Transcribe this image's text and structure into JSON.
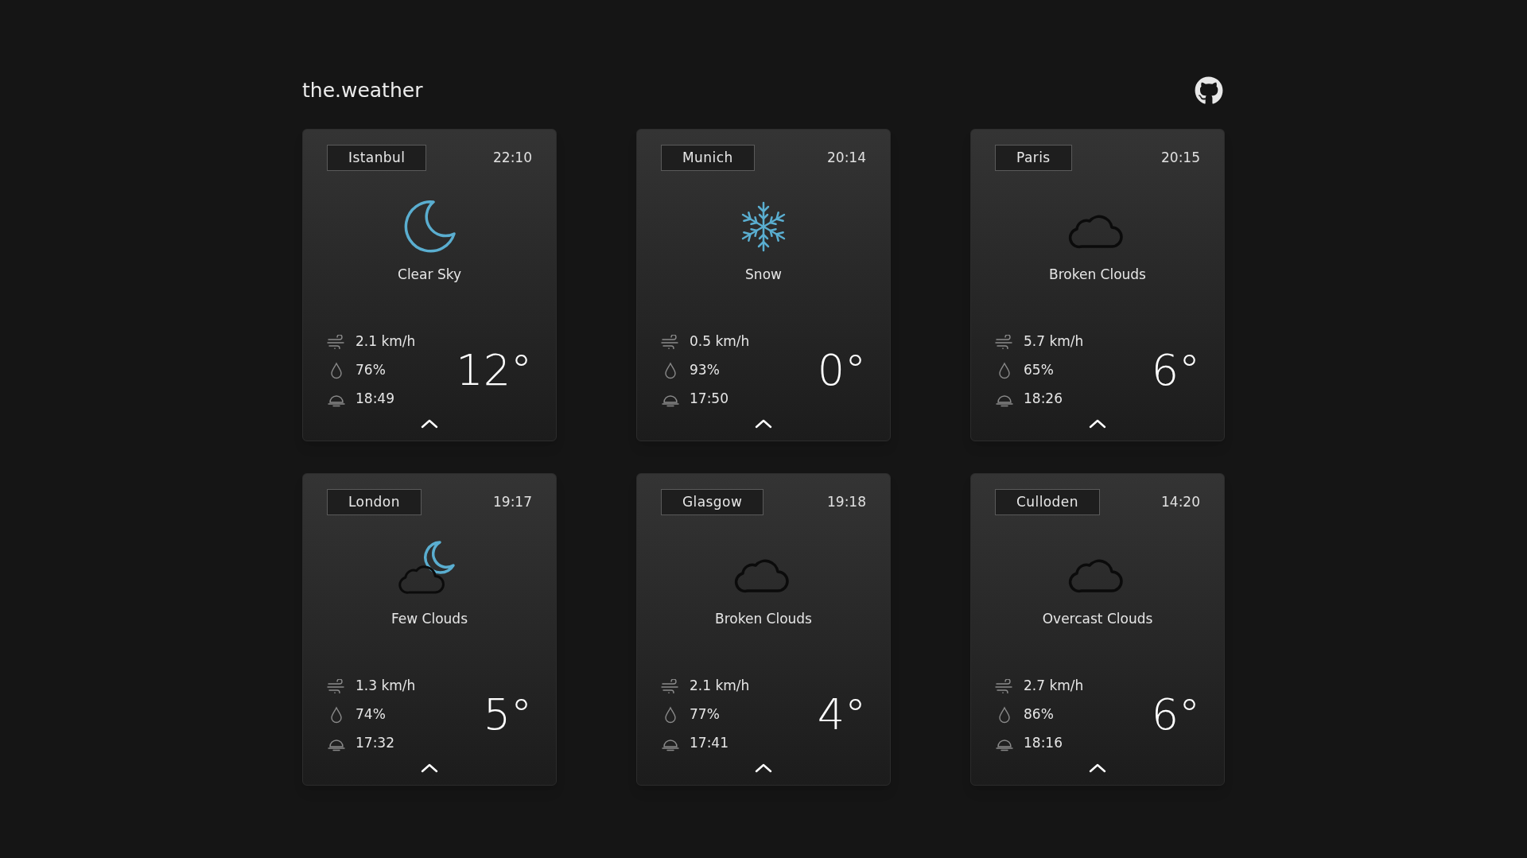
{
  "header": {
    "title": "the.weather"
  },
  "cards": [
    {
      "city": "Istanbul",
      "time": "22:10",
      "kind": "moon",
      "condition": "Clear Sky",
      "wind": "2.1 km/h",
      "humidity": "76%",
      "sunset": "18:49",
      "temperature": "12°"
    },
    {
      "city": "Munich",
      "time": "20:14",
      "kind": "snow",
      "condition": "Snow",
      "wind": "0.5 km/h",
      "humidity": "93%",
      "sunset": "17:50",
      "temperature": "0°"
    },
    {
      "city": "Paris",
      "time": "20:15",
      "kind": "cloud",
      "condition": "Broken Clouds",
      "wind": "5.7 km/h",
      "humidity": "65%",
      "sunset": "18:26",
      "temperature": "6°"
    },
    {
      "city": "London",
      "time": "19:17",
      "kind": "moon_cloud",
      "condition": "Few Clouds",
      "wind": "1.3 km/h",
      "humidity": "74%",
      "sunset": "17:32",
      "temperature": "5°"
    },
    {
      "city": "Glasgow",
      "time": "19:18",
      "kind": "cloud",
      "condition": "Broken Clouds",
      "wind": "2.1 km/h",
      "humidity": "77%",
      "sunset": "17:41",
      "temperature": "4°"
    },
    {
      "city": "Culloden",
      "time": "14:20",
      "kind": "cloud",
      "condition": "Overcast Clouds",
      "wind": "2.7 km/h",
      "humidity": "86%",
      "sunset": "18:16",
      "temperature": "6°"
    }
  ]
}
